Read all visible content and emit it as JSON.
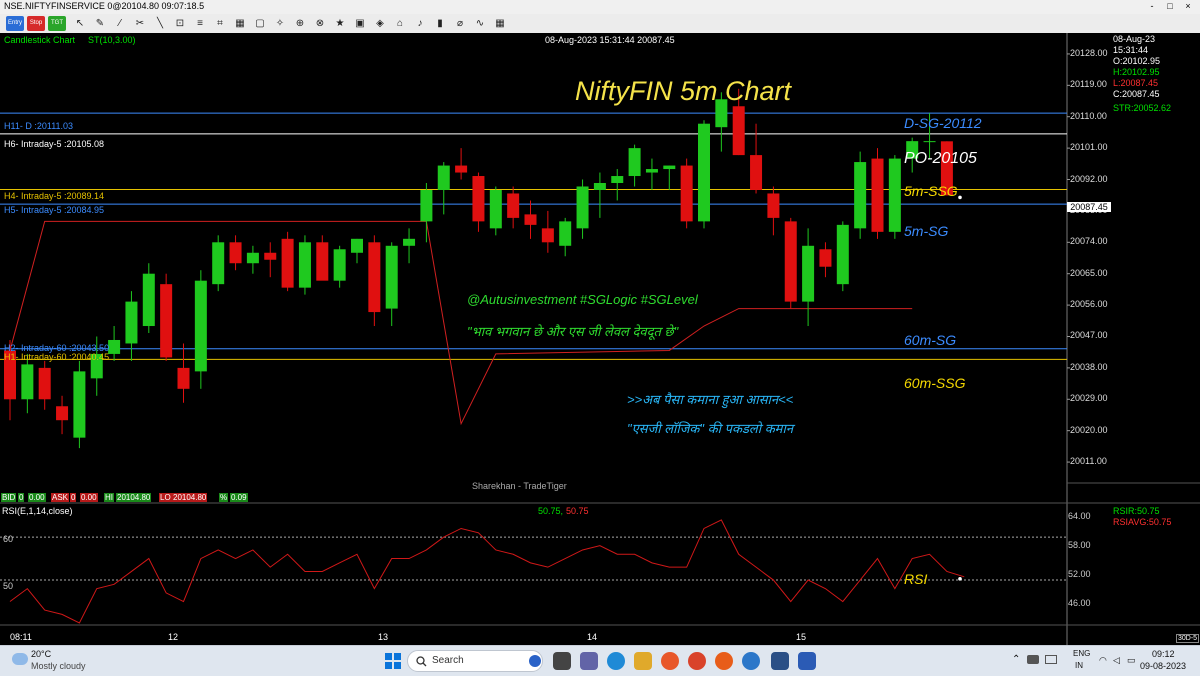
{
  "window": {
    "title": "NSE.NIFTYFINSERVICE 0@20104.80 09:07:18.5",
    "controls": [
      "-",
      "□",
      "×"
    ]
  },
  "toolbar": {
    "entry_label": "Entry",
    "stop_label": "Stop",
    "tgt_label": "TGT",
    "tools": [
      "↖",
      "✎",
      "⁄",
      "✂",
      "╲",
      "⊡",
      "≡",
      "⌗",
      "▦",
      "▢",
      "✧",
      "⊕",
      "⊗",
      "★",
      "▣",
      "◈",
      "⌂",
      "♪",
      "▮",
      "⌀",
      "∿",
      "▦"
    ]
  },
  "chart_header": {
    "chart_type": "Candlestick Chart",
    "indicator": "ST(10,3.00)",
    "timestamp": "08-Aug-2023 15:31:44 20087.45",
    "watermark": "Sharekhan - TradeTiger"
  },
  "info_panel": {
    "date": "08-Aug-23",
    "time": "15:31:44",
    "open": "O:20102.95",
    "high": "H:20102.95",
    "low": "L:20087.45",
    "close": "C:20087.45",
    "str": "STR:20052.62"
  },
  "level_labels": {
    "h11": "H11- D :20111.03",
    "h6": "H6- Intraday-5 :20105.08",
    "h4": "H4- Intraday-5 :20089.14",
    "h5": "H5- Intraday-5 :20084.95",
    "h2": "H2- Intraday-60 :20043.50",
    "h1": "H1- Intraday-60 :20040.45"
  },
  "annotations": {
    "title": "NiftyFIN 5m Chart",
    "dsg": "D-SG-20112",
    "po": "PO-20105",
    "ssg5": "5m-SSG",
    "sg5": "5m-SG",
    "sg60": "60m-SG",
    "ssg60": "60m-SSG",
    "handle": "@Autusinvestment  #SGLogic  #SGLevel",
    "quote": "\"भाव भगवान छे और एस जी लेवल देवदूत छे\"",
    "promo1": ">>अब पैसा कमाना हुआ आसान<<",
    "promo2": "\"एसजी लॉजिक\" की पकडलो कमान",
    "rsi": "RSI"
  },
  "price_axis": {
    "ticks": [
      "20128.00",
      "20119.00",
      "20110.00",
      "20101.00",
      "20092.00",
      "20083.00",
      "20074.00",
      "20065.00",
      "20056.00",
      "20047.00",
      "20038.00",
      "20029.00",
      "20020.00",
      "20011.00"
    ],
    "current": "20087.45"
  },
  "bid_bar": {
    "bid_label": "BID",
    "bid_qty": "0",
    "bid_price": "0.00",
    "ask_label": "ASK",
    "ask_qty": "0",
    "ask_price": "0.00",
    "hi_label": "HI",
    "hi_value": "20104.80",
    "lo_label": "LO",
    "lo_value": "20104.80",
    "pct_label": "%",
    "pct_value": "0.09"
  },
  "rsi_panel": {
    "label": "RSI(E,1,14,close)",
    "value_green": "50.75,",
    "value_red": "50.75",
    "rsir": "RSIR:50.75",
    "rsiavg": "RSIAVG:50.75",
    "left_ticks": [
      "60",
      "50"
    ],
    "right_ticks": [
      "64.00",
      "58.00",
      "52.00",
      "46.00"
    ]
  },
  "x_axis": {
    "labels": [
      "08:11",
      "12",
      "13",
      "14",
      "15"
    ],
    "corner": "30D-5"
  },
  "taskbar": {
    "weather_temp": "20°C",
    "weather_desc": "Mostly cloudy",
    "search_placeholder": "Search",
    "lang1": "ENG",
    "lang2": "IN",
    "time": "09:12",
    "date": "09-08-2023"
  },
  "chart_data": {
    "type": "candlestick",
    "title": "NiftyFIN 5m Chart",
    "ylim": [
      20005,
      20134
    ],
    "candles": [
      {
        "o": 20043,
        "h": 20046,
        "l": 20023,
        "c": 20029
      },
      {
        "o": 20029,
        "h": 20042,
        "l": 20025,
        "c": 20039
      },
      {
        "o": 20038,
        "h": 20040,
        "l": 20026,
        "c": 20029
      },
      {
        "o": 20027,
        "h": 20030,
        "l": 20019,
        "c": 20023
      },
      {
        "o": 20018,
        "h": 20040,
        "l": 20015,
        "c": 20037
      },
      {
        "o": 20035,
        "h": 20047,
        "l": 20030,
        "c": 20042
      },
      {
        "o": 20042,
        "h": 20050,
        "l": 20040,
        "c": 20046
      },
      {
        "o": 20045,
        "h": 20060,
        "l": 20040,
        "c": 20057
      },
      {
        "o": 20050,
        "h": 20068,
        "l": 20048,
        "c": 20065
      },
      {
        "o": 20062,
        "h": 20065,
        "l": 20040,
        "c": 20041
      },
      {
        "o": 20038,
        "h": 20045,
        "l": 20028,
        "c": 20032
      },
      {
        "o": 20037,
        "h": 20066,
        "l": 20032,
        "c": 20063
      },
      {
        "o": 20062,
        "h": 20076,
        "l": 20060,
        "c": 20074
      },
      {
        "o": 20074,
        "h": 20076,
        "l": 20066,
        "c": 20068
      },
      {
        "o": 20068,
        "h": 20073,
        "l": 20065,
        "c": 20071
      },
      {
        "o": 20071,
        "h": 20074,
        "l": 20064,
        "c": 20069
      },
      {
        "o": 20075,
        "h": 20077,
        "l": 20060,
        "c": 20061
      },
      {
        "o": 20061,
        "h": 20076,
        "l": 20059,
        "c": 20074
      },
      {
        "o": 20074,
        "h": 20076,
        "l": 20064,
        "c": 20063
      },
      {
        "o": 20063,
        "h": 20073,
        "l": 20061,
        "c": 20072
      },
      {
        "o": 20071,
        "h": 20075,
        "l": 20068,
        "c": 20075
      },
      {
        "o": 20074,
        "h": 20076,
        "l": 20050,
        "c": 20054
      },
      {
        "o": 20055,
        "h": 20074,
        "l": 20050,
        "c": 20073
      },
      {
        "o": 20073,
        "h": 20078,
        "l": 20068,
        "c": 20075
      },
      {
        "o": 20080,
        "h": 20091,
        "l": 20074,
        "c": 20089
      },
      {
        "o": 20089,
        "h": 20097,
        "l": 20082,
        "c": 20096
      },
      {
        "o": 20096,
        "h": 20101,
        "l": 20092,
        "c": 20094
      },
      {
        "o": 20093,
        "h": 20094,
        "l": 20077,
        "c": 20080
      },
      {
        "o": 20078,
        "h": 20090,
        "l": 20076,
        "c": 20089
      },
      {
        "o": 20088,
        "h": 20090,
        "l": 20078,
        "c": 20081
      },
      {
        "o": 20082,
        "h": 20086,
        "l": 20075,
        "c": 20079
      },
      {
        "o": 20078,
        "h": 20083,
        "l": 20071,
        "c": 20074
      },
      {
        "o": 20073,
        "h": 20081,
        "l": 20070,
        "c": 20080
      },
      {
        "o": 20078,
        "h": 20092,
        "l": 20075,
        "c": 20090
      },
      {
        "o": 20089,
        "h": 20094,
        "l": 20081,
        "c": 20091
      },
      {
        "o": 20091,
        "h": 20095,
        "l": 20086,
        "c": 20093
      },
      {
        "o": 20093,
        "h": 20102,
        "l": 20090,
        "c": 20101
      },
      {
        "o": 20094,
        "h": 20098,
        "l": 20089,
        "c": 20095
      },
      {
        "o": 20095,
        "h": 20096,
        "l": 20089,
        "c": 20096
      },
      {
        "o": 20096,
        "h": 20098,
        "l": 20078,
        "c": 20080
      },
      {
        "o": 20080,
        "h": 20109,
        "l": 20078,
        "c": 20108
      },
      {
        "o": 20107,
        "h": 20117,
        "l": 20100,
        "c": 20115
      },
      {
        "o": 20113,
        "h": 20118,
        "l": 20099,
        "c": 20099
      },
      {
        "o": 20099,
        "h": 20108,
        "l": 20088,
        "c": 20089
      },
      {
        "o": 20088,
        "h": 20090,
        "l": 20076,
        "c": 20081
      },
      {
        "o": 20080,
        "h": 20081,
        "l": 20055,
        "c": 20057
      },
      {
        "o": 20057,
        "h": 20078,
        "l": 20050,
        "c": 20073
      },
      {
        "o": 20072,
        "h": 20074,
        "l": 20064,
        "c": 20067
      },
      {
        "o": 20062,
        "h": 20080,
        "l": 20060,
        "c": 20079
      },
      {
        "o": 20078,
        "h": 20100,
        "l": 20075,
        "c": 20097
      },
      {
        "o": 20098,
        "h": 20101,
        "l": 20075,
        "c": 20077
      },
      {
        "o": 20077,
        "h": 20099,
        "l": 20075,
        "c": 20098
      },
      {
        "o": 20098,
        "h": 20104,
        "l": 20094,
        "c": 20103
      },
      {
        "o": 20103,
        "h": 20111,
        "l": 20098,
        "c": 20103
      },
      {
        "o": 20102.95,
        "h": 20102.95,
        "l": 20087.45,
        "c": 20087.45
      }
    ],
    "levels": [
      {
        "name": "H11- D",
        "value": 20111.03
      },
      {
        "name": "H6- Intraday-5",
        "value": 20105.08
      },
      {
        "name": "H4- Intraday-5",
        "value": 20089.14
      },
      {
        "name": "H5- Intraday-5",
        "value": 20084.95
      },
      {
        "name": "H2- Intraday-60",
        "value": 20043.5
      },
      {
        "name": "H1- Intraday-60",
        "value": 20040.45
      }
    ],
    "rsi": {
      "ylim": [
        40,
        67
      ],
      "values": [
        45,
        48,
        43,
        42,
        40,
        48,
        49,
        52,
        55,
        47,
        45,
        55,
        57,
        55,
        57,
        53,
        56,
        52,
        52,
        54,
        56,
        48,
        55,
        55,
        57,
        60,
        62,
        61,
        57,
        56,
        54,
        53,
        55,
        57,
        58,
        56,
        56,
        54,
        53,
        53,
        62,
        64,
        56,
        53,
        50,
        45,
        50,
        48,
        45,
        50,
        55,
        48,
        55,
        56,
        52,
        50.75
      ]
    },
    "supertrend": [
      [
        0,
        20043
      ],
      [
        0,
        20043
      ],
      [
        0,
        20043
      ],
      [
        2,
        20080
      ],
      [
        24,
        20080
      ],
      [
        26,
        20022
      ],
      [
        28,
        20042
      ],
      [
        38,
        20043
      ],
      [
        40,
        20050
      ],
      [
        42,
        20055
      ],
      [
        52,
        20055
      ]
    ]
  }
}
